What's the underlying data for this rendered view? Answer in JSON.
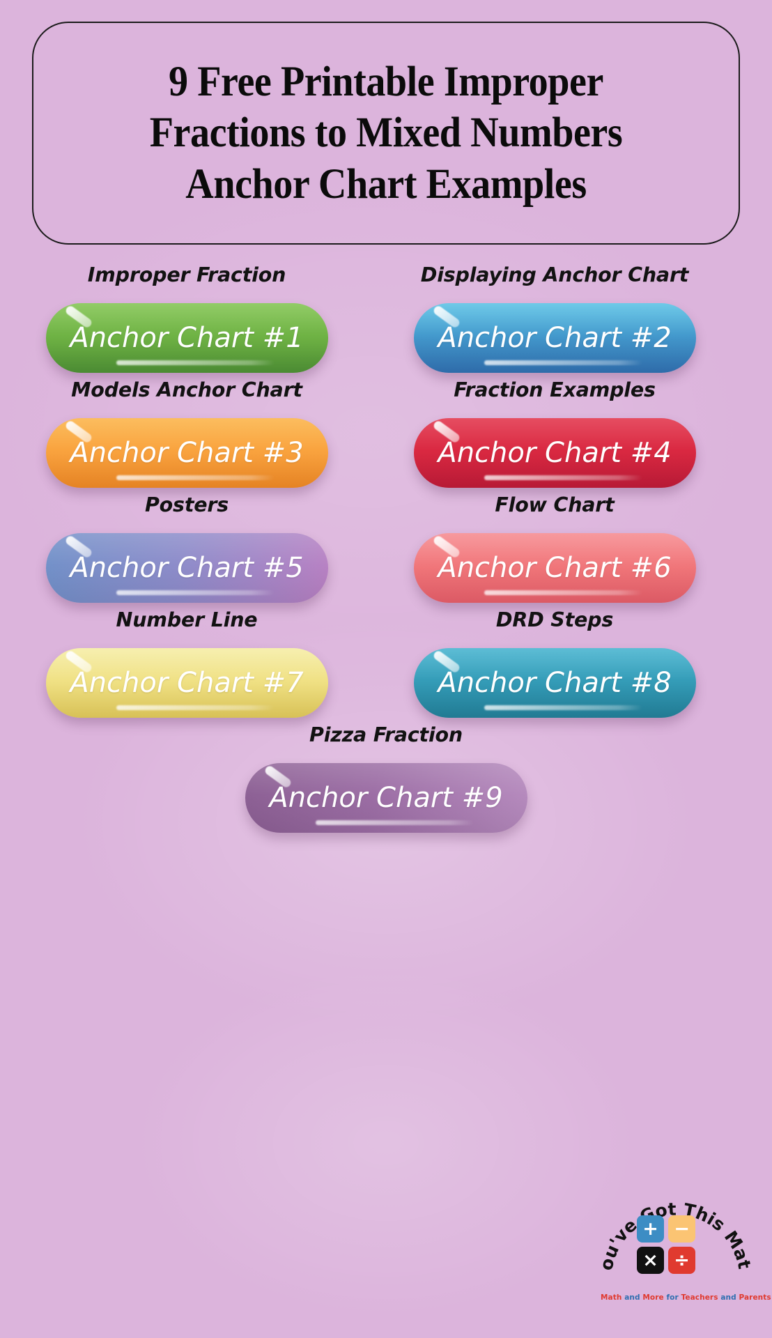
{
  "page": {
    "background_color": "#dcb4dc",
    "title": "9 Free Printable Improper Fractions to Mixed Numbers Anchor Chart Examples",
    "title_line_1": "9 Free Printable Improper",
    "title_line_2": "Fractions to Mixed Numbers",
    "title_line_3": "Anchor Chart Examples"
  },
  "items": [
    {
      "label": "Improper Fraction",
      "button": "Anchor Chart #1",
      "color": "#69ae3f"
    },
    {
      "label": "Displaying Anchor Chart",
      "button": "Anchor Chart #2",
      "color": "#3e93c9"
    },
    {
      "label": "Models Anchor Chart",
      "button": "Anchor Chart #3",
      "color": "#f9a03a"
    },
    {
      "label": "Fraction Examples",
      "button": "Anchor Chart #4",
      "color": "#d8243d"
    },
    {
      "label": "Posters",
      "button": "Anchor Chart #5",
      "color": "#8c8ac9"
    },
    {
      "label": "Flow Chart",
      "button": "Anchor Chart #6",
      "color": "#f07276"
    },
    {
      "label": "Number Line",
      "button": "Anchor Chart #7",
      "color": "#efdf7f"
    },
    {
      "label": "DRD Steps",
      "button": "Anchor Chart #8",
      "color": "#2f98b4"
    },
    {
      "label": "Pizza Fraction",
      "button": "Anchor Chart #9",
      "color": "#9a6ba3"
    }
  ],
  "logo": {
    "brand_curved_text": "You've Got This Math",
    "tagline": "Math and More for Teachers and Parents",
    "tiles": [
      {
        "symbol": "+",
        "name": "plus",
        "color": "#3d8dc4"
      },
      {
        "symbol": "−",
        "name": "minus",
        "color": "#fbc473"
      },
      {
        "symbol": "×",
        "name": "times",
        "color": "#111111"
      },
      {
        "symbol": "÷",
        "name": "divide",
        "color": "#e03a2f"
      }
    ]
  }
}
